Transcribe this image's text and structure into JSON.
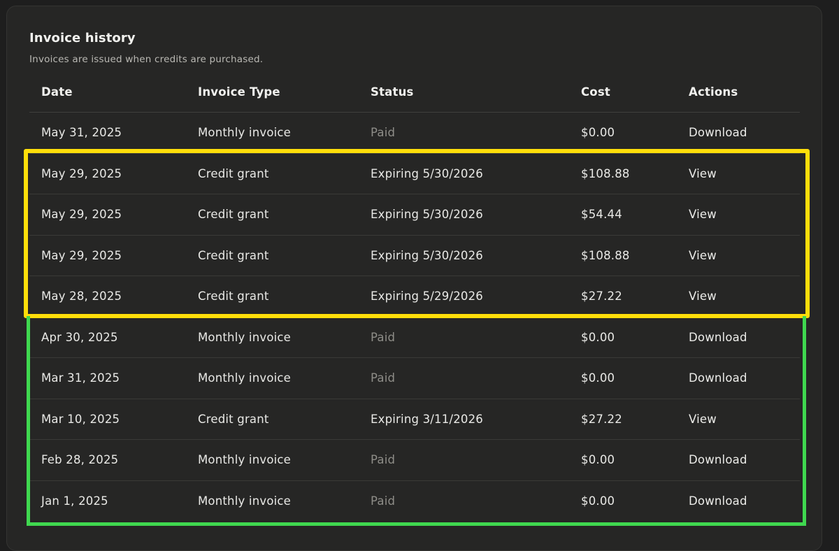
{
  "page": {
    "title": "Invoice history",
    "subtitle": "Invoices are issued when credits are purchased."
  },
  "table": {
    "columns": [
      "Date",
      "Invoice Type",
      "Status",
      "Cost",
      "Actions"
    ],
    "rows": [
      {
        "date": "May 31, 2025",
        "type": "Monthly invoice",
        "status": "Paid",
        "cost": "$0.00",
        "action": "Download"
      },
      {
        "date": "May 29, 2025",
        "type": "Credit grant",
        "status": "Expiring 5/30/2026",
        "cost": "$108.88",
        "action": "View"
      },
      {
        "date": "May 29, 2025",
        "type": "Credit grant",
        "status": "Expiring 5/30/2026",
        "cost": "$54.44",
        "action": "View"
      },
      {
        "date": "May 29, 2025",
        "type": "Credit grant",
        "status": "Expiring 5/30/2026",
        "cost": "$108.88",
        "action": "View"
      },
      {
        "date": "May 28, 2025",
        "type": "Credit grant",
        "status": "Expiring 5/29/2026",
        "cost": "$27.22",
        "action": "View"
      },
      {
        "date": "Apr 30, 2025",
        "type": "Monthly invoice",
        "status": "Paid",
        "cost": "$0.00",
        "action": "Download"
      },
      {
        "date": "Mar 31, 2025",
        "type": "Monthly invoice",
        "status": "Paid",
        "cost": "$0.00",
        "action": "Download"
      },
      {
        "date": "Mar 10, 2025",
        "type": "Credit grant",
        "status": "Expiring 3/11/2026",
        "cost": "$27.22",
        "action": "View"
      },
      {
        "date": "Feb 28, 2025",
        "type": "Monthly invoice",
        "status": "Paid",
        "cost": "$0.00",
        "action": "Download"
      },
      {
        "date": "Jan 1, 2025",
        "type": "Monthly invoice",
        "status": "Paid",
        "cost": "$0.00",
        "action": "Download"
      }
    ]
  },
  "colors": {
    "background": "#1e1e1e",
    "card": "#262625",
    "paid_status": "#8e8d88",
    "highlight_yellow": "#ffde0a",
    "highlight_green": "#3fd84f"
  }
}
